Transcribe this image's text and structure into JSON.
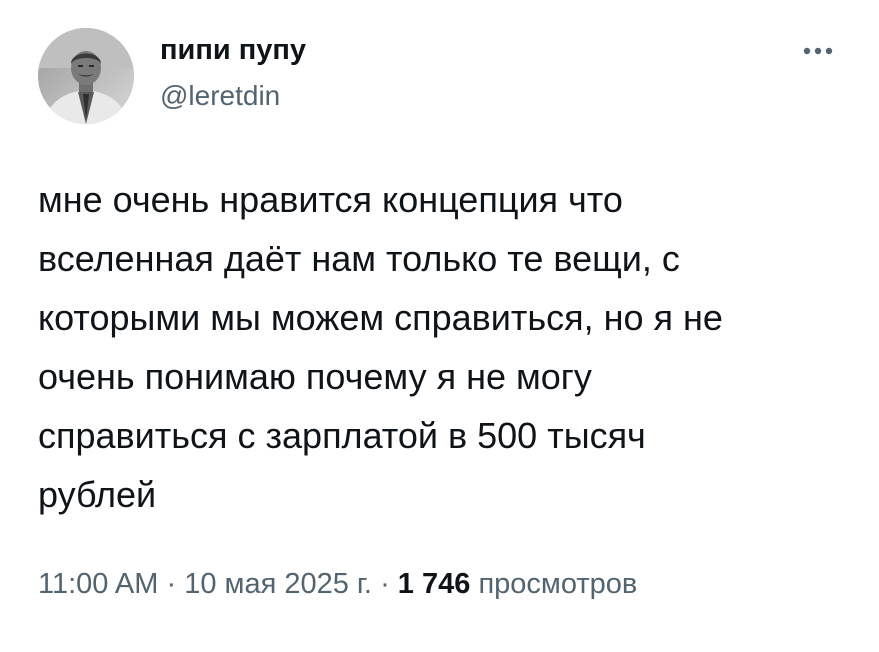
{
  "author": {
    "display_name": "пипи пупу",
    "handle": "@leretdin",
    "avatar_icon": "person-photo-avatar"
  },
  "tweet": {
    "text": "мне очень нравится концепция что\nвселенная даёт нам только те вещи, с\nкоторыми мы можем справиться, но я не\nочень понимаю почему я не могу\nсправиться с зарплатой в 500 тысяч\nрублей",
    "time": "11:00 AM",
    "separator": "·",
    "date": "10 мая 2025 г.",
    "views_count": "1 746",
    "views_label": "просмотров"
  },
  "menu": {
    "icon": "more-horizontal-icon"
  },
  "colors": {
    "text_primary": "#0f1419",
    "text_secondary": "#536471",
    "background": "#ffffff"
  }
}
